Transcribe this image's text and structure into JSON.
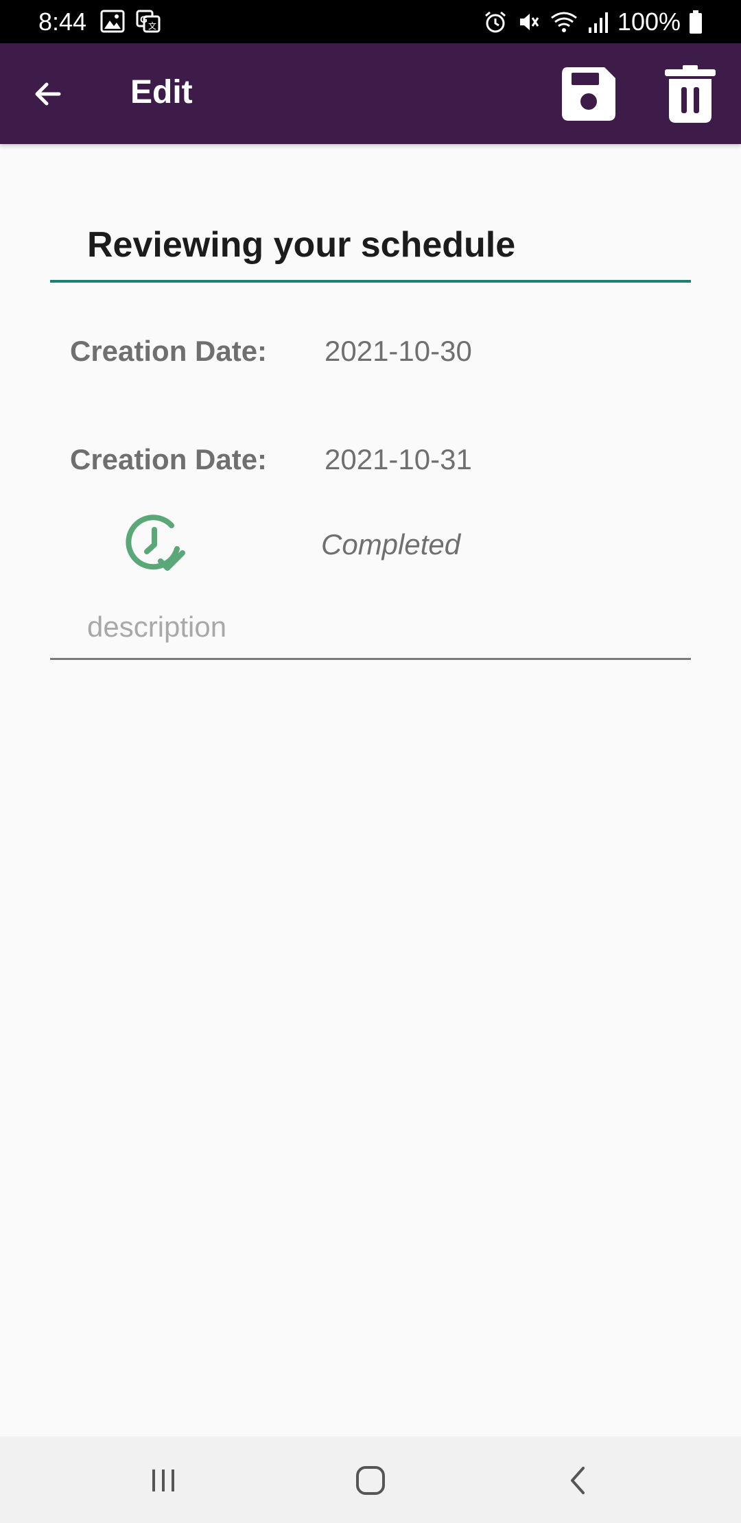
{
  "status_bar": {
    "time": "8:44",
    "battery": "100%",
    "icons_left": [
      "image-icon",
      "translate-icon"
    ],
    "icons_right": [
      "alarm-icon",
      "mute-icon",
      "wifi-icon",
      "signal-icon",
      "battery-icon"
    ]
  },
  "app_bar": {
    "title": "Edit",
    "background": "#3d1c4a",
    "back_icon": "arrow-back-icon",
    "save_icon": "floppy-disk-icon",
    "delete_icon": "trash-icon"
  },
  "form": {
    "title_value": "Reviewing your schedule",
    "accent_color": "#1b8273",
    "rows": [
      {
        "label": "Creation Date:",
        "value": "2021-10-30"
      },
      {
        "label": "Creation Date:",
        "value": "2021-10-31"
      }
    ],
    "status": {
      "icon": "clock-check-icon",
      "icon_color": "#5aa878",
      "text": "Completed"
    },
    "description_placeholder": "description"
  },
  "nav_bar": {
    "recents_icon": "recents-icon",
    "home_icon": "home-icon",
    "back_icon": "back-chevron-icon"
  }
}
